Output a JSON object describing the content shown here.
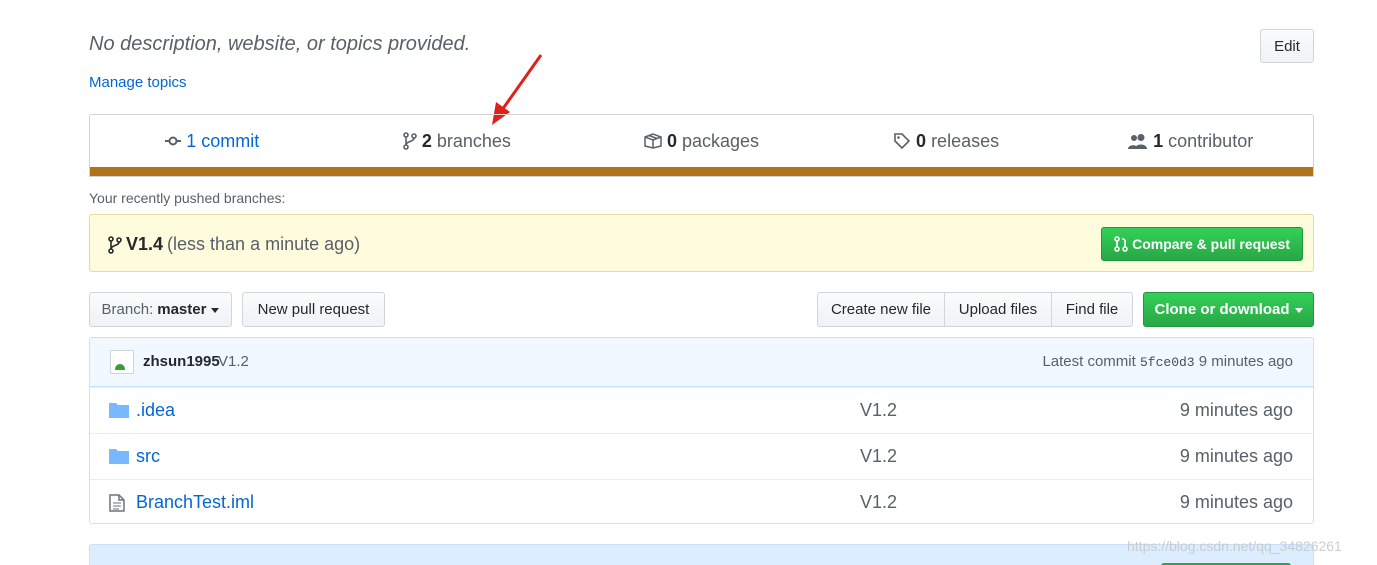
{
  "repo": {
    "description": "No description, website, or topics provided.",
    "manage_topics": "Manage topics",
    "edit_label": "Edit"
  },
  "numbers": {
    "commits_count": "1",
    "commits_label": "commit",
    "branches_count": "2",
    "branches_label": "branches",
    "packages_count": "0",
    "packages_label": "packages",
    "releases_count": "0",
    "releases_label": "releases",
    "contributors_count": "1",
    "contributors_label": "contributor"
  },
  "language_bar_color": "#b07219",
  "recent": {
    "label": "Your recently pushed branches:",
    "branch": "V1.4",
    "time": "(less than a minute ago)",
    "compare_label": "Compare & pull request"
  },
  "toolbar": {
    "branch_prefix": "Branch:",
    "branch_name": "master",
    "new_pr": "New pull request",
    "create_file": "Create new file",
    "upload_files": "Upload files",
    "find_file": "Find file",
    "clone": "Clone or download"
  },
  "commit": {
    "author": "zhsun1995",
    "message": "V1.2",
    "latest_prefix": "Latest commit",
    "sha": "5fce0d3",
    "age": "9 minutes ago"
  },
  "files": [
    {
      "name": ".idea",
      "type": "folder-icon",
      "message": "V1.2",
      "age": "9 minutes ago"
    },
    {
      "name": "src",
      "type": "folder-icon",
      "message": "V1.2",
      "age": "9 minutes ago"
    },
    {
      "name": "BranchTest.iml",
      "type": "file-icon",
      "message": "V1.2",
      "age": "9 minutes ago"
    }
  ],
  "watermark": "https://blog.csdn.net/qq_34826261"
}
